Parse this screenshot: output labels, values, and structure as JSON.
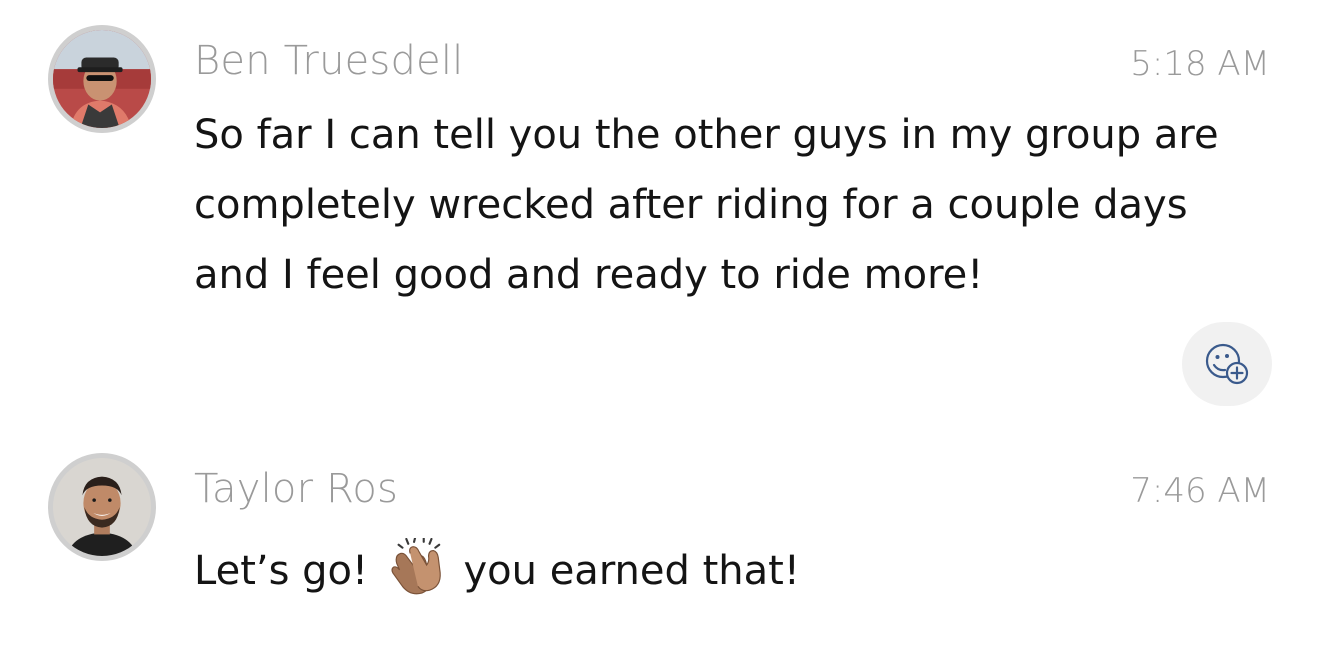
{
  "messages": [
    {
      "author": "Ben Truesdell",
      "time": "5:18 AM",
      "text": "So far I can tell you the other guys in my group are completely wrecked after riding for a couple days and I feel good and ready to ride more!"
    },
    {
      "author": "Taylor Ros",
      "time": "7:46 AM",
      "text_before": "Let’s go!",
      "emoji": "clapping-hands",
      "text_after": "you earned that!"
    }
  ],
  "icons": {
    "reaction": "add-reaction-icon"
  },
  "colors": {
    "meta_gray": "#9a9a9a",
    "text": "#141414",
    "reaction_bg": "#f1f1f1",
    "icon_blue": "#3a5a8c"
  }
}
